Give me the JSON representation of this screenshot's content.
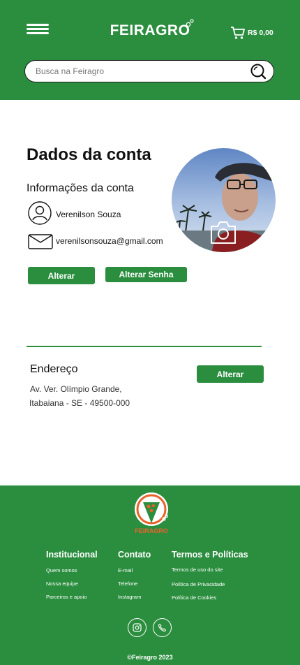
{
  "colors": {
    "brand_green": "#2b8e3f",
    "logo_orange": "#e8622a"
  },
  "header": {
    "logo": "FEIRAGRO",
    "cart_value": "R$ 0,00",
    "search_placeholder": "Busca na Feiragro"
  },
  "account": {
    "title": "Dados da conta",
    "subtitle": "Informações da conta",
    "name": "Verenilson Souza",
    "email": "verenilsonsouza@gmail.com",
    "change_button": "Alterar",
    "change_password_button": "Alterar Senha"
  },
  "address": {
    "title": "Endereço",
    "line1": "Av. Ver. Olímpio Grande,",
    "line2": "Itabaiana - SE - 49500-000",
    "change_button": "Alterar"
  },
  "footer": {
    "logo": "FEIRAGRO",
    "columns": [
      {
        "title": "Institucional",
        "links": [
          "Quem somos",
          "Nossa equipe",
          "Parceiros e apoio"
        ]
      },
      {
        "title": "Contato",
        "links": [
          "E-mail",
          "Telefone",
          "Instagram"
        ]
      },
      {
        "title": "Termos e Políticas",
        "links": [
          "Termos de uso do site",
          "Política de Privacidade",
          "Política de Cookies"
        ]
      }
    ],
    "social_icons": [
      "instagram-icon",
      "phone-icon"
    ],
    "copyright": "©Feiragro 2023"
  }
}
